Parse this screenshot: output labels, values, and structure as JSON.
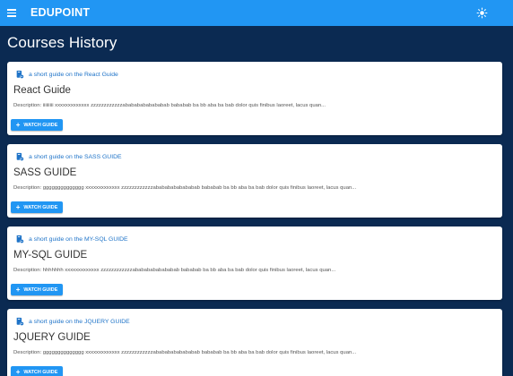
{
  "header": {
    "title": "EDUPOINT",
    "menu_icon": "menu-icon",
    "theme_icon": "brightness-icon"
  },
  "page": {
    "title": "Courses History"
  },
  "courses": [
    {
      "subtitle": "a short guide on the React Guide",
      "title": "React Guide",
      "description": "Description: iiiiiiiii xxxxxxxxxxxxx zzzzzzzzzzzzabababababababab bababab ba bb aba ba bab dolor quis finibus laoreet, lacus quan...",
      "button_label": "WATCH GUIDE"
    },
    {
      "subtitle": "a short guide on the SASS GUIDE",
      "title": "SASS GUIDE",
      "description": "Description: gggggggggggggg xxxxxxxxxxxxx zzzzzzzzzzzzabababababababab bababab ba bb aba ba bab dolor quis finibus laoreet, lacus quan...",
      "button_label": "WATCH GUIDE"
    },
    {
      "subtitle": "a short guide on the MY-SQL GUIDE",
      "title": "MY-SQL GUIDE",
      "description": "Description: hhhhhhh xxxxxxxxxxxxx zzzzzzzzzzzzabababababababab bababab ba bb aba ba bab dolor quis finibus laoreet, lacus quan...",
      "button_label": "WATCH GUIDE"
    },
    {
      "subtitle": "a short guide on the JQUERY GUIDE",
      "title": "JQUERY GUIDE",
      "description": "Description: gggggggggggggg xxxxxxxxxxxxx zzzzzzzzzzzzabababababababab bababab ba bb aba ba bab dolor quis finibus laoreet, lacus quan...",
      "button_label": "WATCH GUIDE"
    }
  ],
  "colors": {
    "appbar": "#2196f3",
    "background": "#0b2a52",
    "accent_text": "#1e73c8"
  }
}
